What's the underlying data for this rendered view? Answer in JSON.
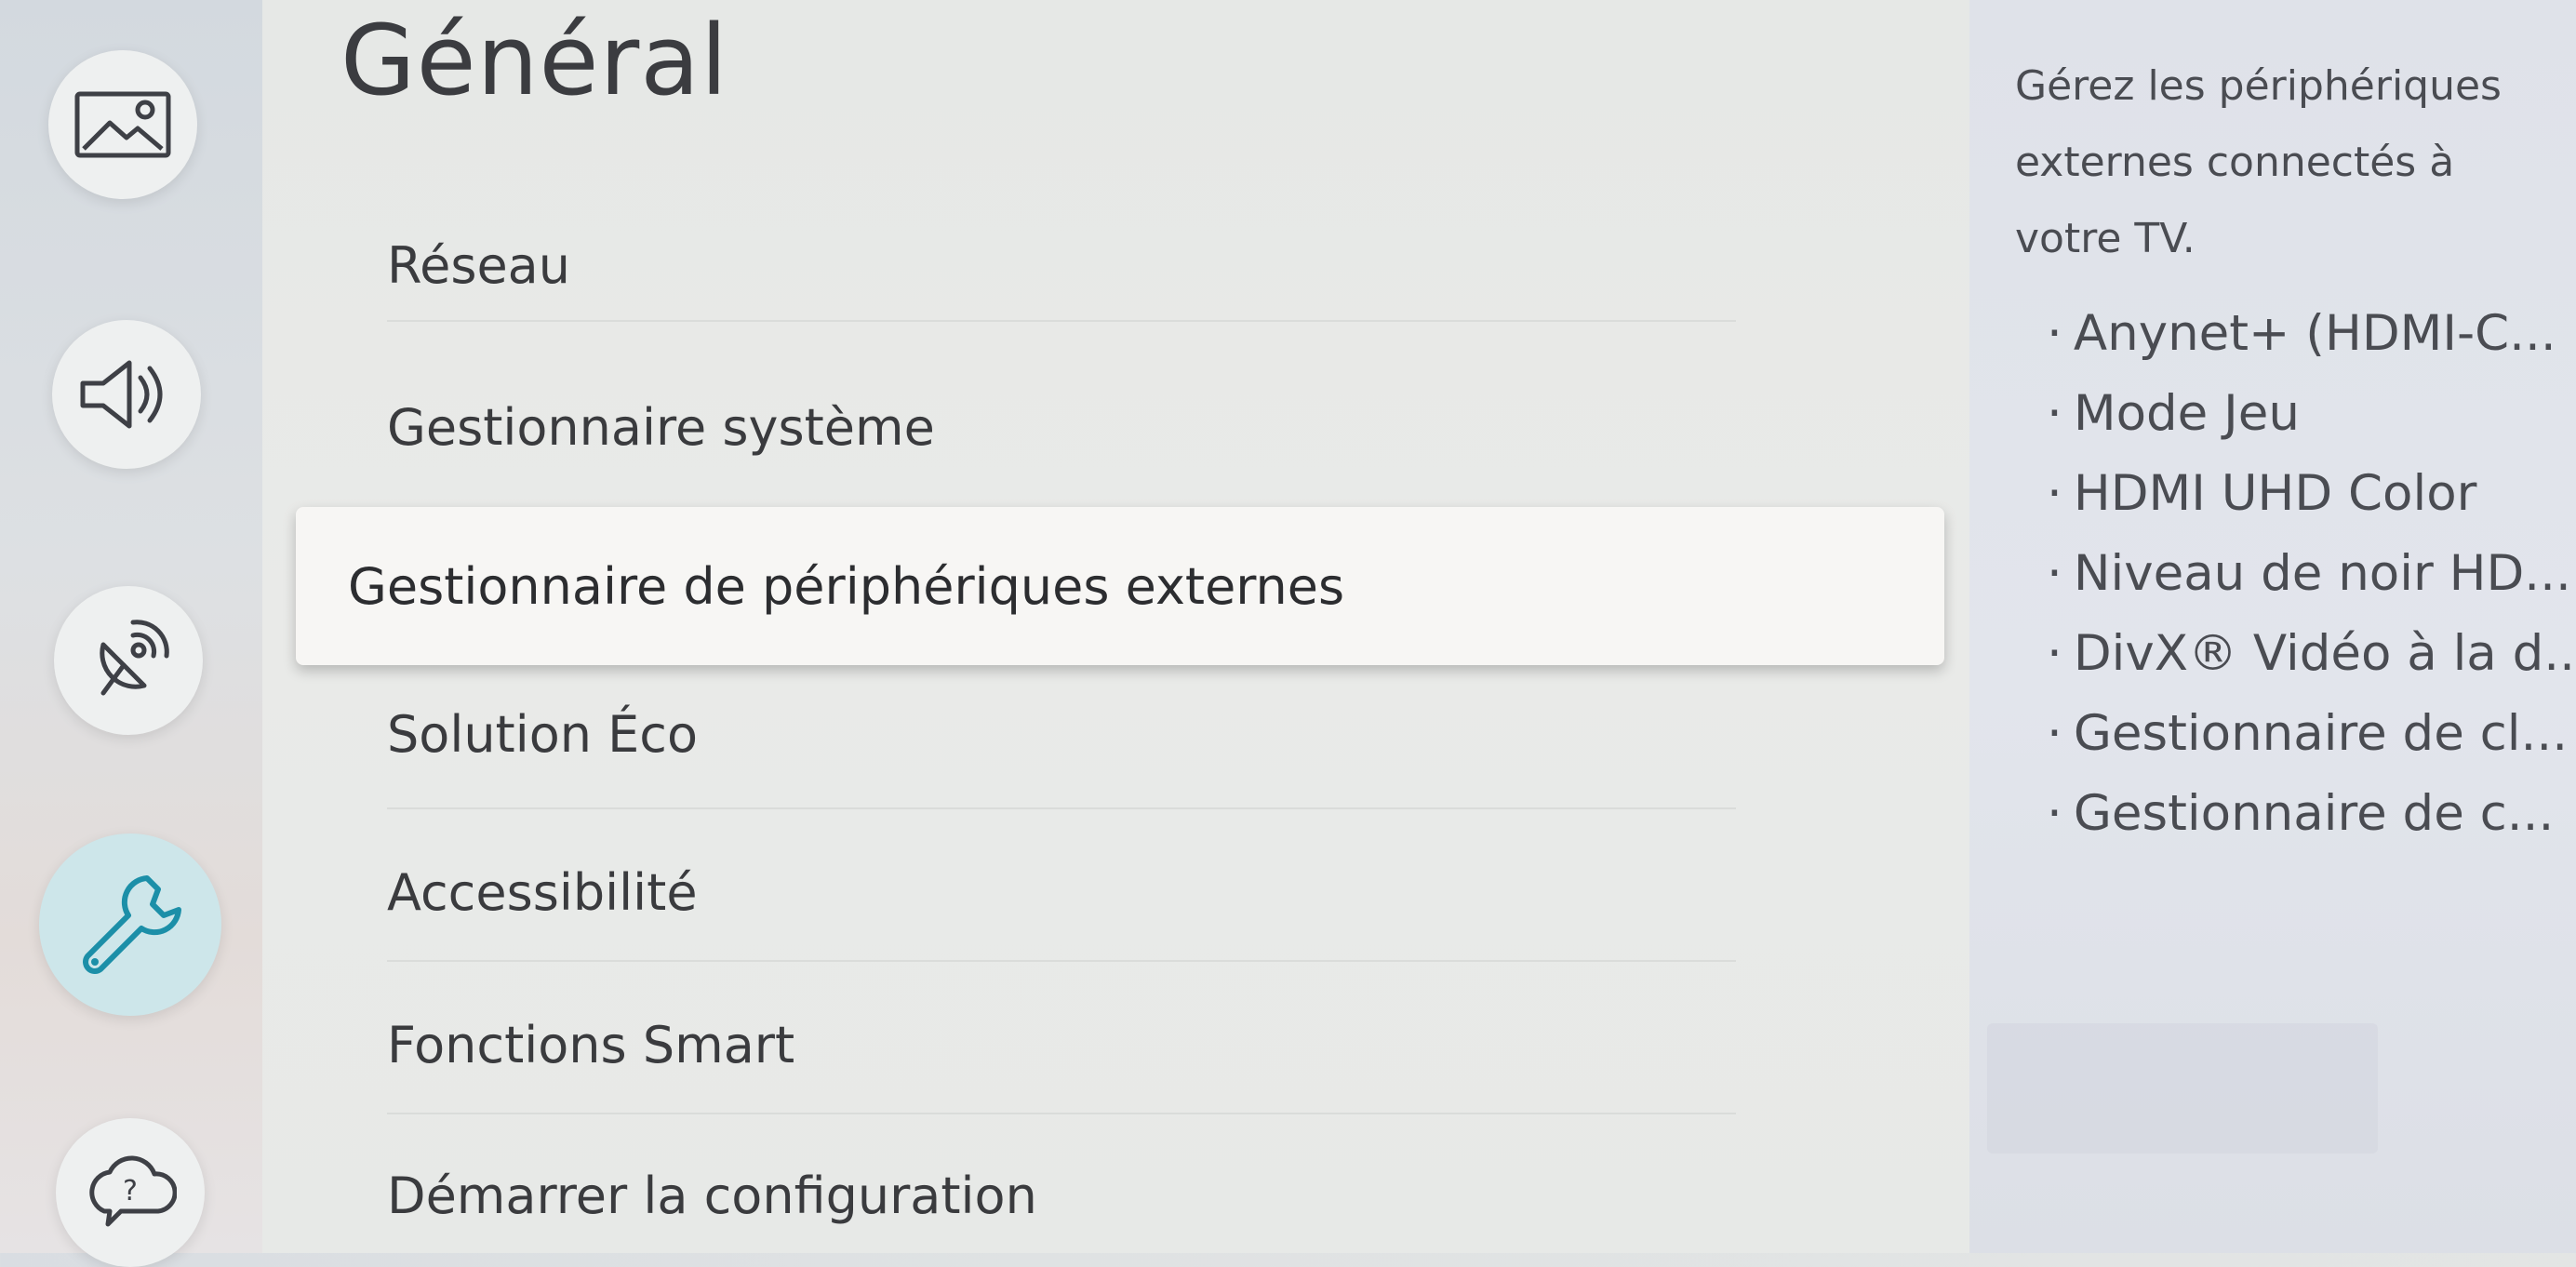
{
  "sidebar": {
    "items": [
      {
        "icon": "picture-icon",
        "label": "Image"
      },
      {
        "icon": "sound-icon",
        "label": "Son"
      },
      {
        "icon": "broadcast-icon",
        "label": "Diffusion"
      },
      {
        "icon": "wrench-icon",
        "label": "Général",
        "active": true
      },
      {
        "icon": "support-icon",
        "label": "Assistance"
      }
    ]
  },
  "main": {
    "title": "Général",
    "menu": [
      {
        "label": "Réseau"
      },
      {
        "label": "Gestionnaire système"
      },
      {
        "label": "Gestionnaire de périphériques externes",
        "selected": true
      },
      {
        "label": "Solution Éco"
      },
      {
        "label": "Accessibilité"
      },
      {
        "label": "Fonctions Smart"
      },
      {
        "label": "Démarrer la configuration"
      }
    ]
  },
  "description": {
    "text": "Gérez les périphériques externes connectés à votre TV.",
    "items": [
      "Anynet+ (HDMI-C...",
      "Mode Jeu",
      "HDMI UHD Color",
      "Niveau de noir HD...",
      "DivX® Vidéo à la d...",
      "Gestionnaire de cl...",
      "Gestionnaire de c..."
    ]
  },
  "colors": {
    "accent": "#cde6ea",
    "icon_active": "#1c8fa8",
    "text": "#3a3b3e"
  }
}
